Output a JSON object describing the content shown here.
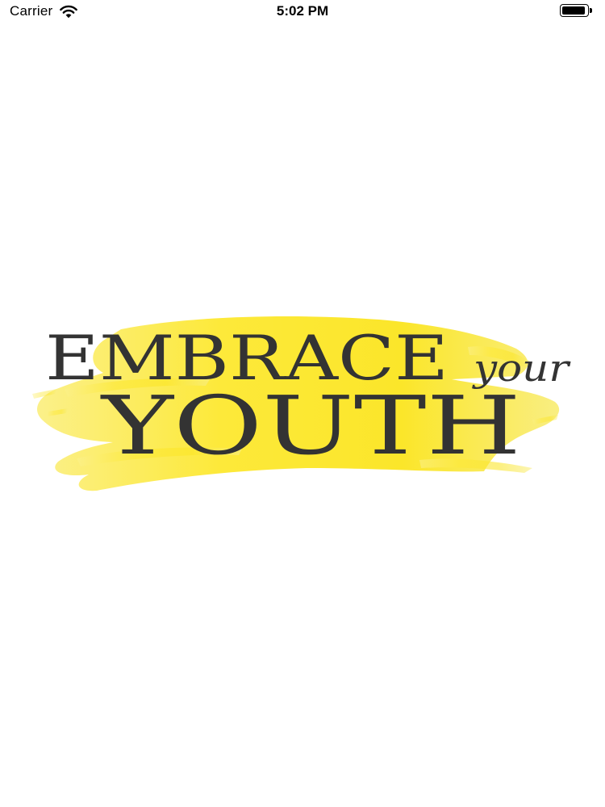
{
  "status_bar": {
    "carrier": "Carrier",
    "time": "5:02 PM",
    "wifi_icon": "wifi-icon",
    "battery_icon": "battery-icon",
    "battery_level": 1.0
  },
  "splash": {
    "logo": {
      "line1": "EMBRACE",
      "script_word": "your",
      "line2": "YOUTH",
      "text_color": "#333333",
      "brush_color": "#fbec3a"
    }
  }
}
